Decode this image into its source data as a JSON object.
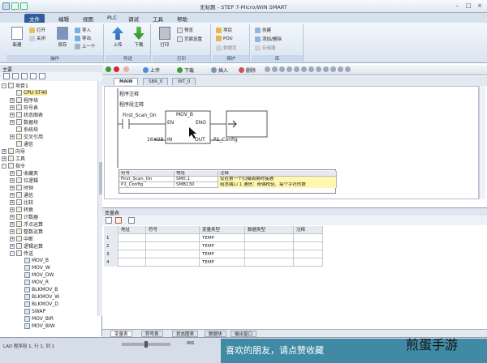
{
  "window": {
    "title": "无标题 - STEP 7-Micro/WIN SMART"
  },
  "ribbon_tabs": [
    "文件",
    "编辑",
    "视图",
    "PLC",
    "调试",
    "工具",
    "帮助"
  ],
  "ribbon": {
    "groups": [
      {
        "label": "操作",
        "buttons": [
          "新建",
          "打开",
          "关闭",
          "保存",
          "导入",
          "导出",
          "上一个"
        ]
      },
      {
        "label": "传送",
        "buttons": [
          "上传",
          "下载"
        ]
      },
      {
        "label": "打印",
        "buttons": [
          "打印",
          "预览",
          "页面设置"
        ]
      },
      {
        "label": "保护",
        "buttons": [
          "项目",
          "POU",
          "数据页"
        ]
      },
      {
        "label": "库",
        "buttons": [
          "创建",
          "添加/删除",
          "存储器"
        ]
      }
    ]
  },
  "left_panel": {
    "title": "主要",
    "tree": [
      {
        "label": "项目1",
        "level": 0,
        "expand": "-"
      },
      {
        "label": "CPU ST40",
        "level": 1,
        "expand": "",
        "selected": true
      },
      {
        "label": "程序块",
        "level": 1,
        "expand": "+"
      },
      {
        "label": "符号表",
        "level": 1,
        "expand": "+"
      },
      {
        "label": "状态图表",
        "level": 1,
        "expand": "+"
      },
      {
        "label": "数据块",
        "level": 1,
        "expand": "+"
      },
      {
        "label": "系统块",
        "level": 1,
        "expand": ""
      },
      {
        "label": "交叉引用",
        "level": 1,
        "expand": "+"
      },
      {
        "label": "通信",
        "level": 1,
        "expand": ""
      },
      {
        "label": "向导",
        "level": 0,
        "expand": "+"
      },
      {
        "label": "工具",
        "level": 0,
        "expand": "+"
      },
      {
        "label": "指令",
        "level": 0,
        "expand": "-"
      },
      {
        "label": "收藏夹",
        "level": 1,
        "expand": "+"
      },
      {
        "label": "位逻辑",
        "level": 1,
        "expand": "+"
      },
      {
        "label": "时钟",
        "level": 1,
        "expand": "+"
      },
      {
        "label": "通信",
        "level": 1,
        "expand": "+"
      },
      {
        "label": "比较",
        "level": 1,
        "expand": "+"
      },
      {
        "label": "转换",
        "level": 1,
        "expand": "+"
      },
      {
        "label": "计数器",
        "level": 1,
        "expand": "+"
      },
      {
        "label": "浮点运算",
        "level": 1,
        "expand": "+"
      },
      {
        "label": "整数运算",
        "level": 1,
        "expand": "+"
      },
      {
        "label": "中断",
        "level": 1,
        "expand": "+"
      },
      {
        "label": "逻辑运算",
        "level": 1,
        "expand": "+"
      },
      {
        "label": "传送",
        "level": 1,
        "expand": "-"
      },
      {
        "label": "MOV_B",
        "level": 2,
        "expand": ""
      },
      {
        "label": "MOV_W",
        "level": 2,
        "expand": ""
      },
      {
        "label": "MOV_DW",
        "level": 2,
        "expand": ""
      },
      {
        "label": "MOV_R",
        "level": 2,
        "expand": ""
      },
      {
        "label": "BLKMOV_B",
        "level": 2,
        "expand": ""
      },
      {
        "label": "BLKMOV_W",
        "level": 2,
        "expand": ""
      },
      {
        "label": "BLKMOV_D",
        "level": 2,
        "expand": ""
      },
      {
        "label": "SWAP",
        "level": 2,
        "expand": ""
      },
      {
        "label": "MOV_BIR",
        "level": 2,
        "expand": ""
      },
      {
        "label": "MOV_BIW",
        "level": 2,
        "expand": ""
      }
    ]
  },
  "toolbar2": {
    "items": [
      "上传",
      "下载",
      "插入",
      "删除"
    ]
  },
  "editor_tabs": [
    "MAIN",
    "SBR_0",
    "INT_0"
  ],
  "editor": {
    "program_comment": "程序注释",
    "network_comment": "程序段注释",
    "contact_label": "First_Scan_On",
    "block_name": "MOV_B",
    "pin_en": "EN",
    "pin_eno": "ENO",
    "pin_in": "IN",
    "pin_out": "OUT",
    "in_value": "16#09",
    "out_value": "P1_Config"
  },
  "symbol_table": {
    "headers": [
      "符号",
      "地址",
      "注释"
    ],
    "rows": [
      [
        "First_Scan_On",
        "SM0.1",
        "仅在第一个扫描周期时接通"
      ],
      [
        "P1_Config",
        "SMB130",
        "组态端口 1 通信：奇偶校验、每个字符的数"
      ]
    ]
  },
  "var_panel": {
    "title": "变量表",
    "headers": [
      "",
      "地址",
      "符号",
      "变量类型",
      "数据类型",
      "注释"
    ],
    "rows": [
      [
        "1",
        "",
        "",
        "TEMP",
        "",
        ""
      ],
      [
        "2",
        "",
        "",
        "TEMP",
        "",
        ""
      ],
      [
        "3",
        "",
        "",
        "TEMP",
        "",
        ""
      ],
      [
        "4",
        "",
        "",
        "TEMP",
        "",
        ""
      ]
    ]
  },
  "bottom_tabs": [
    "变量表",
    "符号表",
    "状态图表",
    "数据块",
    "输出窗口"
  ],
  "statusbar": {
    "text": "LAD 程序段 1, 行 1, 列 1",
    "ins": "INS"
  },
  "banner": {
    "text": "喜欢的朋友，请点赞收藏",
    "logo": "煎蛋手游"
  },
  "colors": {
    "accent": "#2f5c9b",
    "ribbon_bg": "#dae4f0",
    "banner_bg": "#1e7896"
  }
}
